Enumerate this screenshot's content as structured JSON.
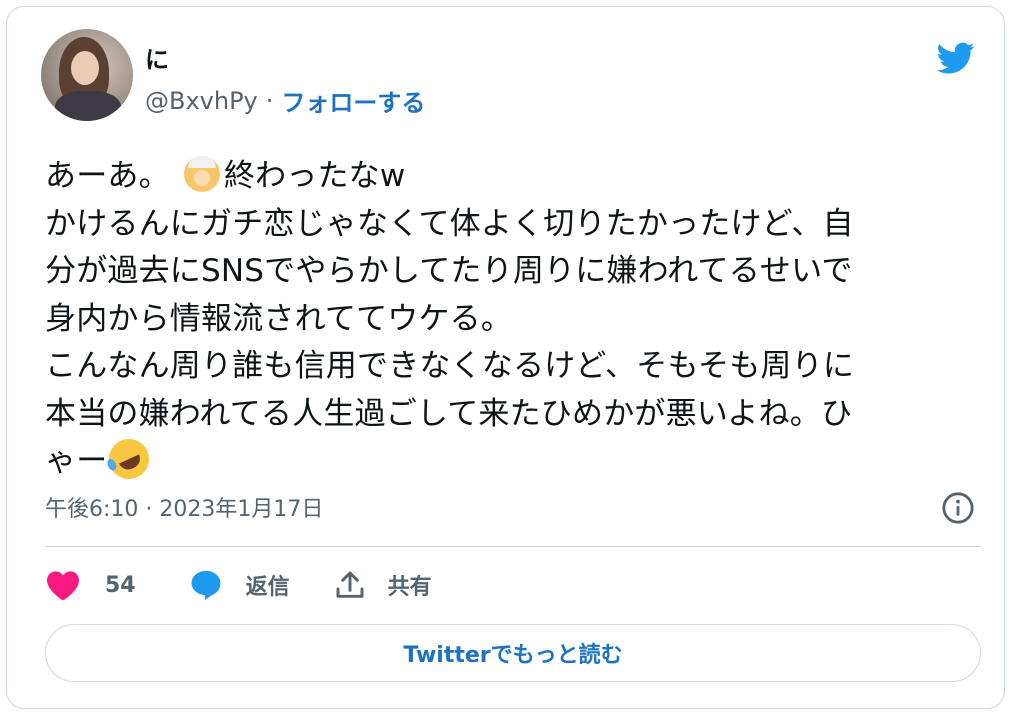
{
  "author": {
    "display_name": "に",
    "handle": "@BxvhPy",
    "separator": "·",
    "follow_label": "フォローする"
  },
  "tweet": {
    "lines": [
      "あーあ。",
      "終わったなw",
      "かけるんにガチ恋じゃなくて体よく切りたかったけど、自",
      "分が過去にSNSでやらかしてたり周りに嫌われてるせいで",
      "身内から情報流されててウケる。",
      "こんなん周り誰も信用できなくなるけど、そもそも周りに",
      "本当の嫌われてる人生過ごして来たひめかが悪いよね。ひ",
      "ゃー"
    ],
    "timestamp": "午後6:10 · 2023年1月17日"
  },
  "actions": {
    "like_count": "54",
    "reply_label": "返信",
    "share_label": "共有"
  },
  "read_more_label": "Twitterでもっと読む",
  "colors": {
    "twitter_blue": "#1d9bf0",
    "link_blue": "#1d72c4",
    "like_pink": "#f91880",
    "muted_gray": "#536471",
    "border": "#cfd9de"
  },
  "icons": [
    "twitter-bird-icon",
    "info-icon",
    "heart-icon",
    "reply-bubble-icon",
    "share-icon",
    "bride-emoji",
    "rofl-emoji"
  ]
}
